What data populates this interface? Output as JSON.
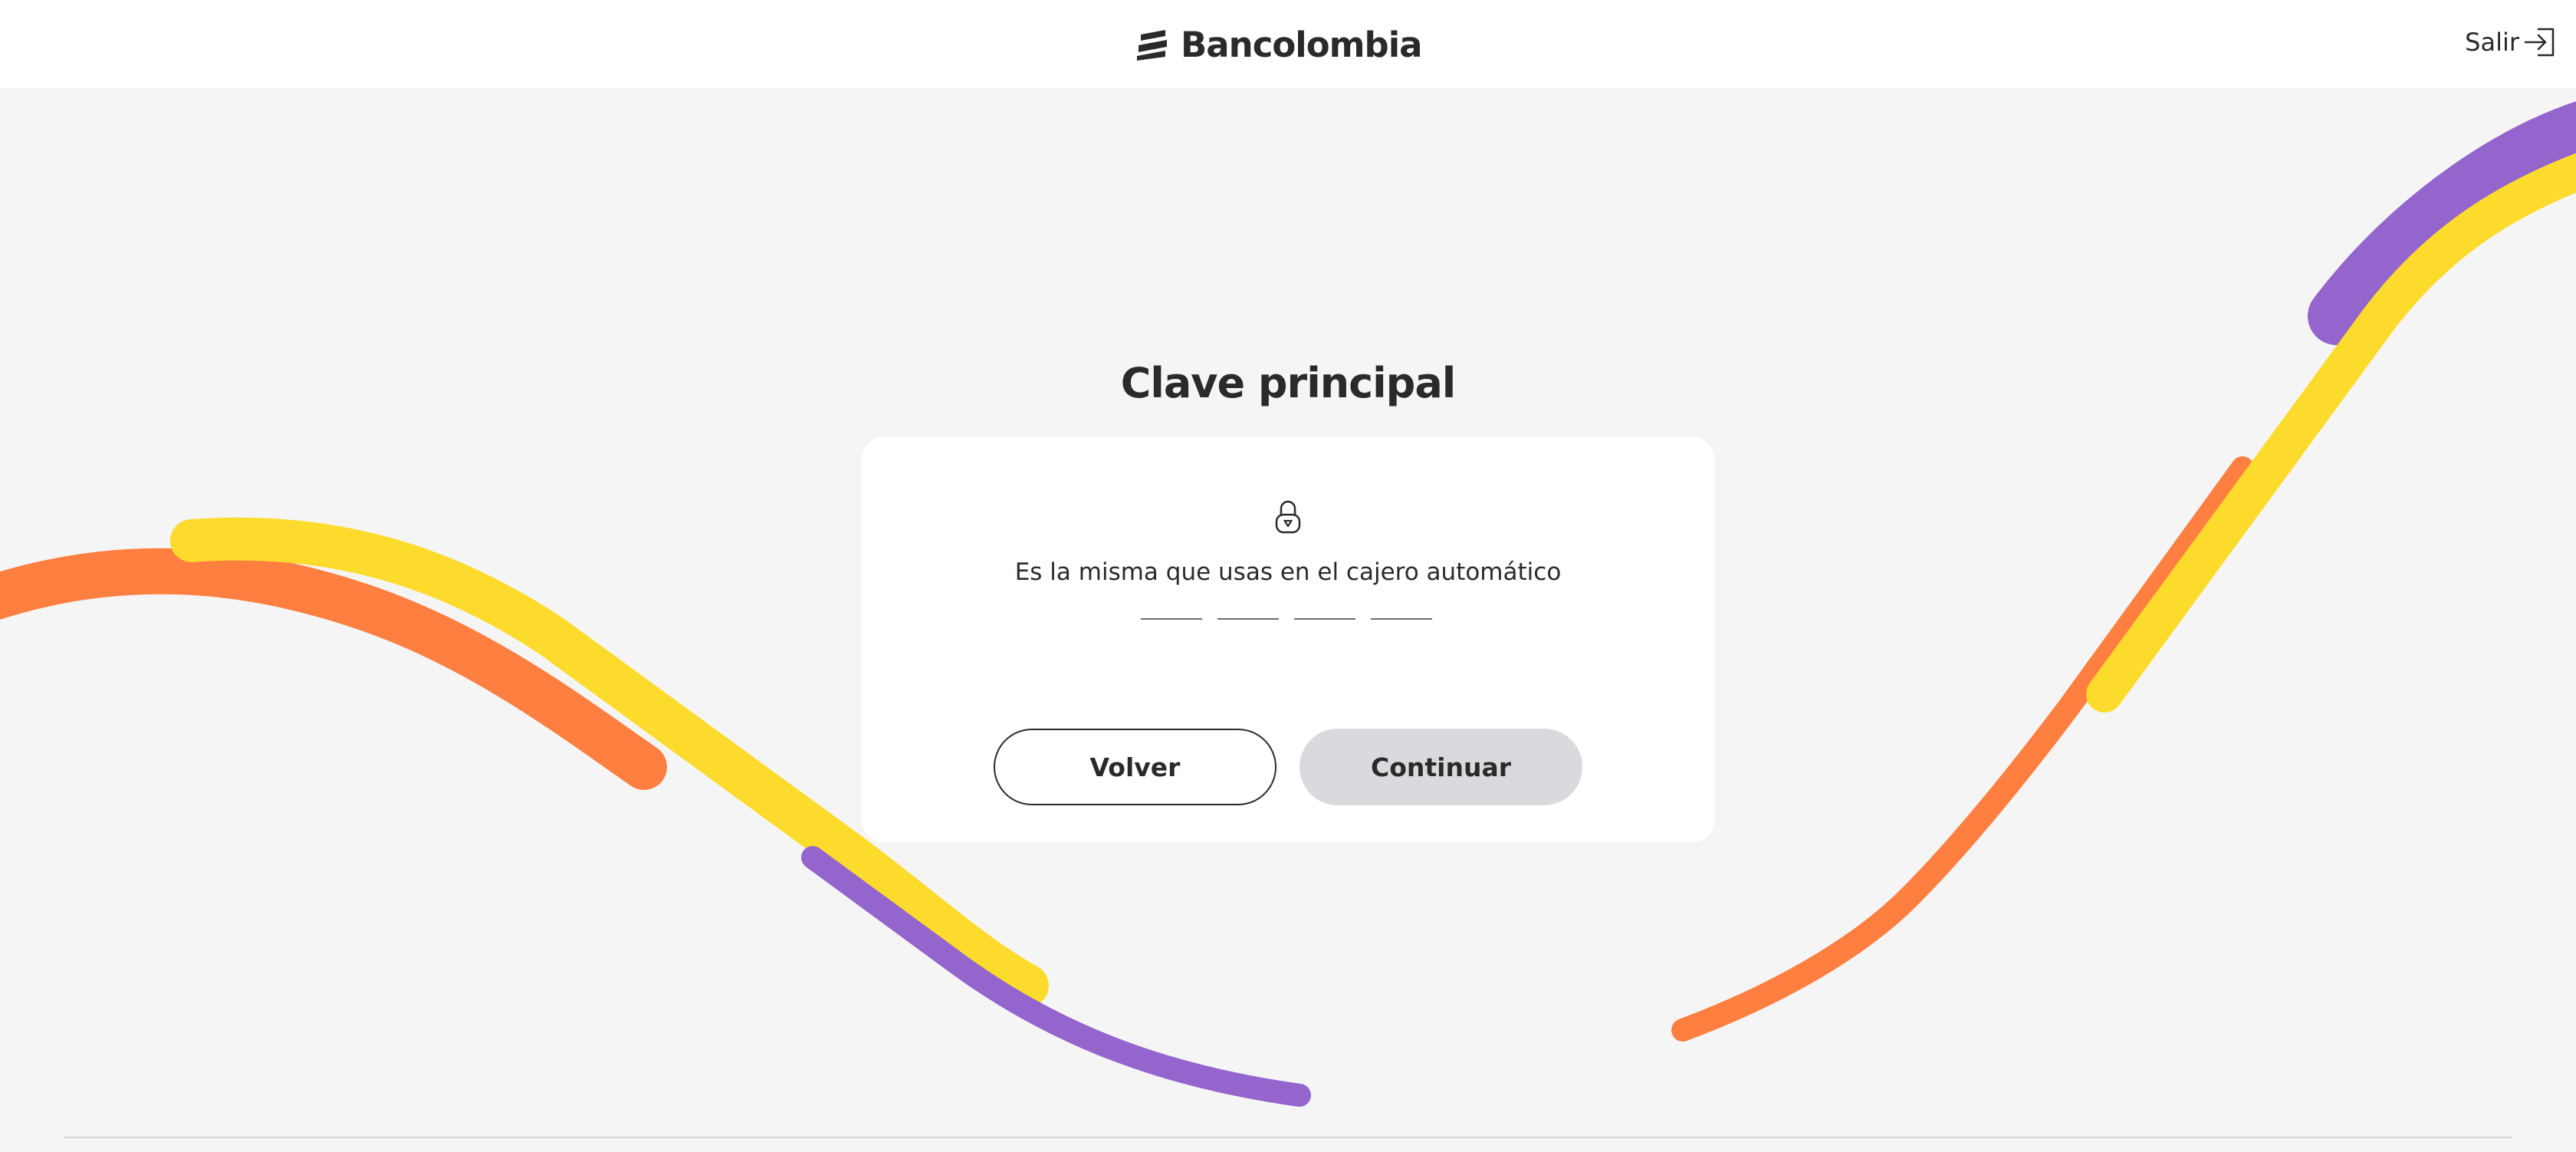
{
  "header": {
    "brand_name": "Bancolombia",
    "exit_label": "Salir"
  },
  "main": {
    "title": "Clave principal",
    "hint": "Es la misma que usas en el cajero automático",
    "pin_slots": 4,
    "back_label": "Volver",
    "continue_label": "Continuar"
  },
  "icons": {
    "brand": "bancolombia-logo-icon",
    "exit": "exit-arrow-icon",
    "lock": "lock-icon"
  },
  "colors": {
    "background": "#f5f5f5",
    "card": "#ffffff",
    "text": "#2c2a29",
    "continue_disabled": "#d9dadd",
    "wave_orange": "#ff7f41",
    "wave_yellow": "#fddb2c",
    "wave_purple": "#9365cd"
  }
}
